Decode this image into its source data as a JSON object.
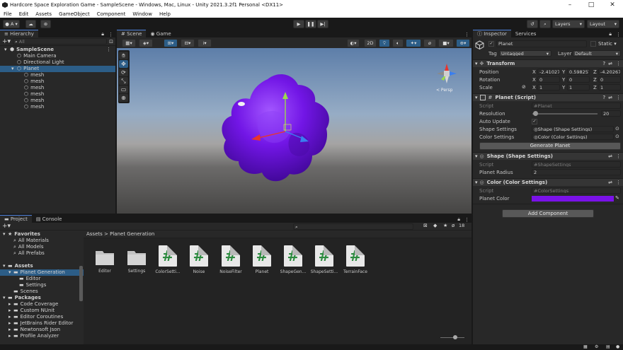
{
  "window": {
    "title": "Hardcore Space Exploration Game - SampleScene - Windows, Mac, Linux - Unity 2021.3.2f1 Personal <DX11>"
  },
  "menu": [
    "File",
    "Edit",
    "Assets",
    "GameObject",
    "Component",
    "Window",
    "Help"
  ],
  "toolbar": {
    "account": "A",
    "layers": "Layers",
    "layout": "Layout"
  },
  "hierarchy": {
    "tab": "Hierarchy",
    "search_placeholder": "All",
    "items": [
      {
        "label": "SampleScene",
        "depth": 0
      },
      {
        "label": "Main Camera",
        "depth": 1
      },
      {
        "label": "Directional Light",
        "depth": 1
      },
      {
        "label": "Planet",
        "depth": 1
      },
      {
        "label": "mesh",
        "depth": 2
      },
      {
        "label": "mesh",
        "depth": 2
      },
      {
        "label": "mesh",
        "depth": 2
      },
      {
        "label": "mesh",
        "depth": 2
      },
      {
        "label": "mesh",
        "depth": 2
      },
      {
        "label": "mesh",
        "depth": 2
      }
    ]
  },
  "scene": {
    "tab_scene": "Scene",
    "tab_game": "Game",
    "mode_2d": "2D",
    "persp": "< Persp"
  },
  "inspector": {
    "tab": "Inspector",
    "tab_services": "Services",
    "object_name": "Planet",
    "static_label": "Static",
    "tag_label": "Tag",
    "tag_value": "Untagged",
    "layer_label": "Layer",
    "layer_value": "Default",
    "transform": {
      "title": "Transform",
      "position_label": "Position",
      "pos_x": "-2.41027",
      "pos_y": "0.598257",
      "pos_z": "-4.20267",
      "rotation_label": "Rotation",
      "rot_x": "0",
      "rot_y": "0",
      "rot_z": "0",
      "scale_label": "Scale",
      "scl_x": "1",
      "scl_y": "1",
      "scl_z": "1"
    },
    "planet_script": {
      "title": "Planet (Script)",
      "script_label": "Script",
      "script_value": "Planet",
      "resolution_label": "Resolution",
      "resolution_value": "20",
      "resolution_fraction": 0.04,
      "auto_update_label": "Auto Update",
      "shape_settings_label": "Shape Settings",
      "shape_settings_value": "Shape (Shape Settings)",
      "color_settings_label": "Color Settings",
      "color_settings_value": "Color (Color Settings)",
      "generate_button": "Generate Planet"
    },
    "shape_settings": {
      "title": "Shape (Shape Settings)",
      "script_label": "Script",
      "script_value": "ShapeSettings",
      "radius_label": "Planet Radius",
      "radius_value": "2"
    },
    "color_settings": {
      "title": "Color (Color Settings)",
      "script_label": "Script",
      "script_value": "ColorSettings",
      "color_label": "Planet Color",
      "color_value": "#7a12e8"
    },
    "add_component": "Add Component"
  },
  "project": {
    "tab_project": "Project",
    "tab_console": "Console",
    "asset_count": "18",
    "breadcrumb_root": "Assets",
    "breadcrumb_sep": ">",
    "breadcrumb_current": "Planet Generation",
    "tree": [
      {
        "label": "Favorites",
        "depth": 0,
        "bold": true
      },
      {
        "label": "All Materials",
        "depth": 1
      },
      {
        "label": "All Models",
        "depth": 1
      },
      {
        "label": "All Prefabs",
        "depth": 1
      },
      {
        "label": "",
        "depth": 0
      },
      {
        "label": "Assets",
        "depth": 0,
        "bold": true
      },
      {
        "label": "Planet Generation",
        "depth": 1
      },
      {
        "label": "Editor",
        "depth": 2
      },
      {
        "label": "Settings",
        "depth": 2
      },
      {
        "label": "Scenes",
        "depth": 1
      },
      {
        "label": "Packages",
        "depth": 0,
        "bold": true
      },
      {
        "label": "Code Coverage",
        "depth": 1
      },
      {
        "label": "Custom NUnit",
        "depth": 1
      },
      {
        "label": "Editor Coroutines",
        "depth": 1
      },
      {
        "label": "JetBrains Rider Editor",
        "depth": 1
      },
      {
        "label": "Newtonsoft Json",
        "depth": 1
      },
      {
        "label": "Profile Analyzer",
        "depth": 1
      }
    ],
    "assets": [
      {
        "label": "Editor",
        "kind": "folder"
      },
      {
        "label": "Settings",
        "kind": "folder"
      },
      {
        "label": "ColorSetti...",
        "kind": "script"
      },
      {
        "label": "Noise",
        "kind": "script"
      },
      {
        "label": "NoiseFilter",
        "kind": "script"
      },
      {
        "label": "Planet",
        "kind": "script"
      },
      {
        "label": "ShapeGen...",
        "kind": "script"
      },
      {
        "label": "ShapeSetti...",
        "kind": "script"
      },
      {
        "label": "TerrainFace",
        "kind": "script"
      }
    ]
  }
}
